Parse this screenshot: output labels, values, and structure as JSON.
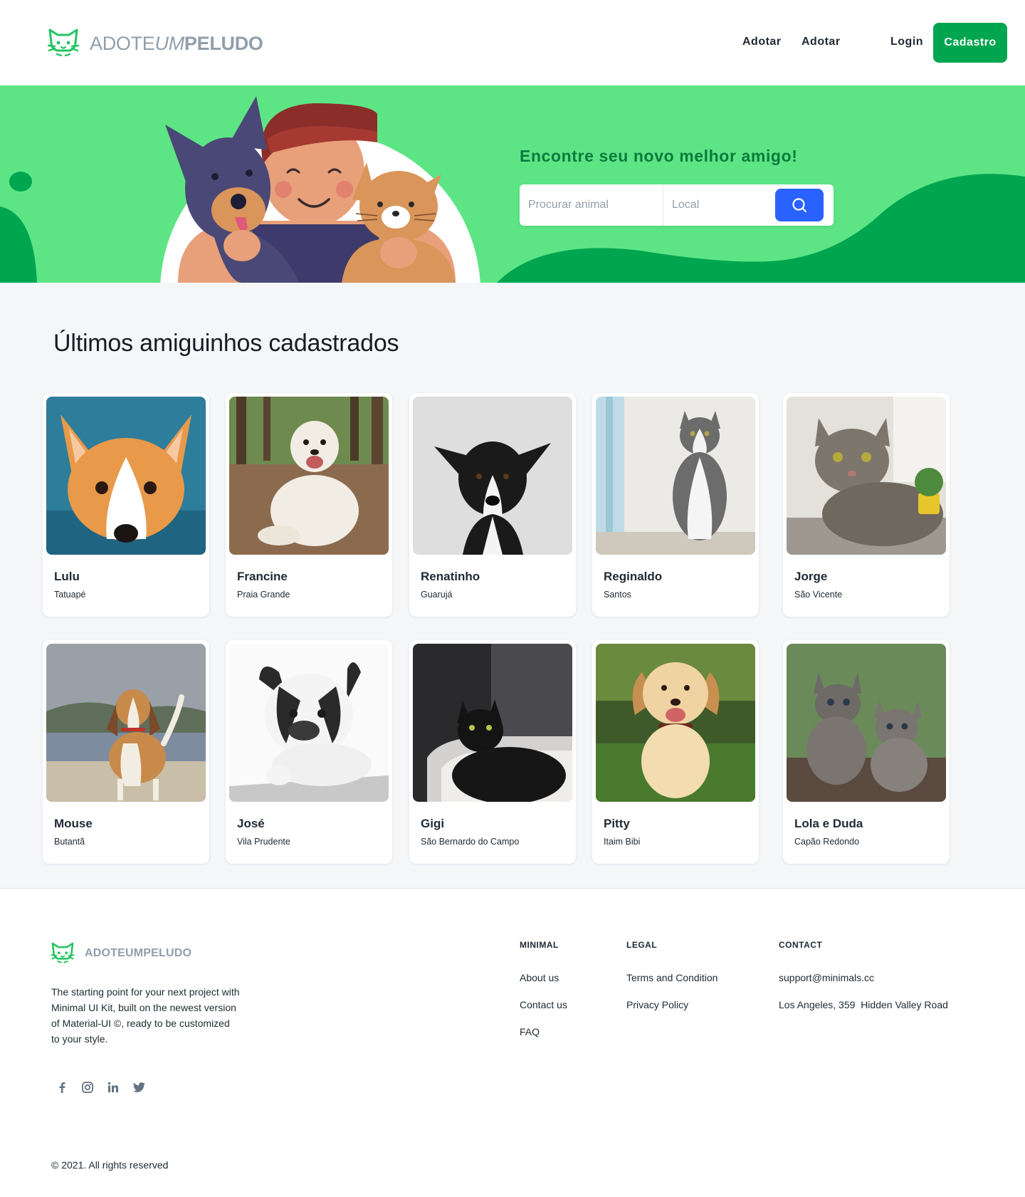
{
  "brand": {
    "name_part1": "ADOTE",
    "name_part2": "UM",
    "name_part3": "PELUDO",
    "footer_name": "ADOTEUMPELUDO",
    "accent": "#00A54F",
    "hero_bg": "#5DE585",
    "search_button_color": "#2962FF"
  },
  "nav": {
    "items": [
      {
        "label": "Adotar"
      },
      {
        "label": "Adotar"
      }
    ],
    "login_label": "Login",
    "signup_label": "Cadastro"
  },
  "hero": {
    "title": "Encontre seu novo melhor amigo!",
    "search_animal_placeholder": "Procurar animal",
    "search_location_placeholder": "Local",
    "search_icon": "search-icon"
  },
  "section": {
    "title": "Últimos amiguinhos cadastrados"
  },
  "pets": [
    {
      "name": "Lulu",
      "location": "Tatuapé"
    },
    {
      "name": "Francine",
      "location": "Praia Grande"
    },
    {
      "name": "Renatinho",
      "location": "Guarujá"
    },
    {
      "name": "Reginaldo",
      "location": "Santos"
    },
    {
      "name": "Jorge",
      "location": "São Vicente"
    },
    {
      "name": "Mouse",
      "location": "Butantã"
    },
    {
      "name": "José",
      "location": "Vila Prudente"
    },
    {
      "name": "Gigi",
      "location": "São Bernardo do Campo"
    },
    {
      "name": "Pitty",
      "location": "Itaim Bibi"
    },
    {
      "name": "Lola e Duda",
      "location": "Capão Redondo"
    }
  ],
  "footer": {
    "description": "The starting point for your next project with Minimal UI Kit, built on the newest version of Material-UI ©, ready to be customized to your style.",
    "socials": [
      "facebook-icon",
      "instagram-icon",
      "linkedin-icon",
      "twitter-icon"
    ],
    "columns": [
      {
        "title": "MINIMAL",
        "links": [
          "About us",
          "Contact us",
          "FAQ"
        ]
      },
      {
        "title": "LEGAL",
        "links": [
          "Terms and Condition",
          "Privacy Policy"
        ]
      },
      {
        "title": "CONTACT",
        "links": [
          "support@minimals.cc",
          "Los Angeles, 359  Hidden Valley Road"
        ]
      }
    ],
    "copyright": "© 2021. All rights reserved"
  }
}
